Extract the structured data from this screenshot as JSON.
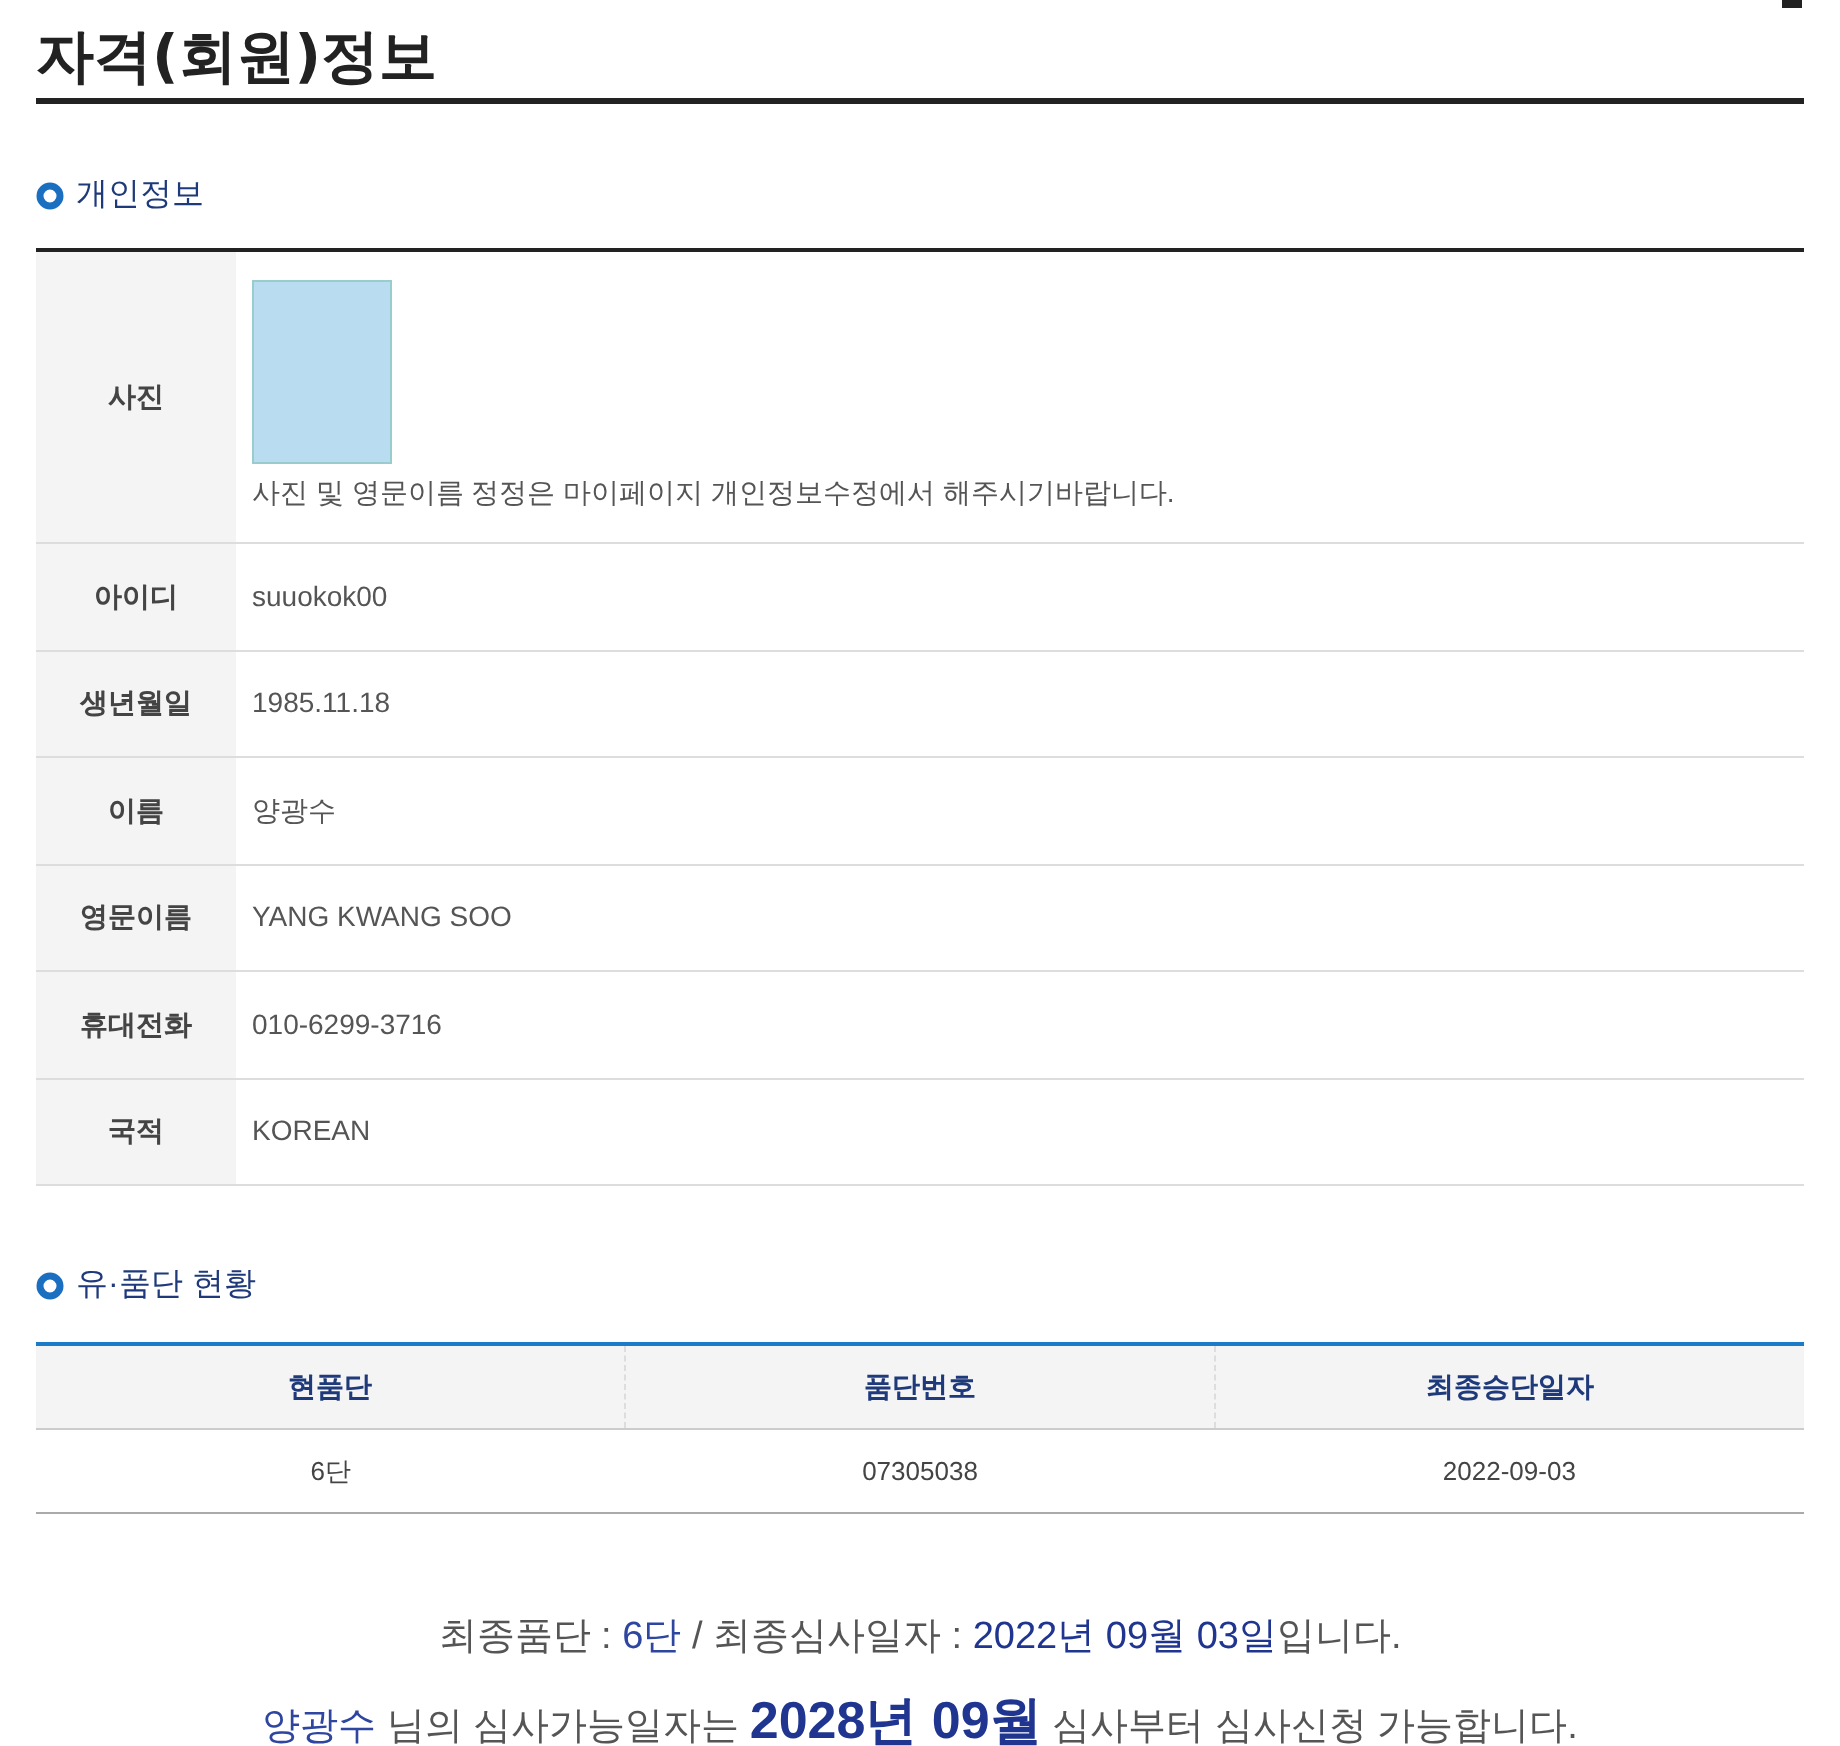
{
  "page_title": "자격(회원)정보",
  "personal_section": {
    "heading": "개인정보",
    "photo_row": {
      "label": "사진",
      "note": "사진 및 영문이름 정정은 마이페이지 개인정보수정에서 해주시기바랍니다."
    },
    "rows": [
      {
        "label": "아이디",
        "value": "suuokok00"
      },
      {
        "label": "생년월일",
        "value": "1985.11.18"
      },
      {
        "label": "이름",
        "value": "양광수"
      },
      {
        "label": "영문이름",
        "value": "YANG KWANG SOO"
      },
      {
        "label": "휴대전화",
        "value": "010-6299-3716"
      },
      {
        "label": "국적",
        "value": "KOREAN"
      }
    ]
  },
  "rank_section": {
    "heading": "유·품단 현황",
    "columns": [
      "현품단",
      "품단번호",
      "최종승단일자"
    ],
    "rows": [
      [
        "6단",
        "07305038",
        "2022-09-03"
      ]
    ]
  },
  "summary_lines": [
    [
      {
        "kind": "plain",
        "text": "최종품단 : "
      },
      {
        "kind": "accent",
        "text": "6단"
      },
      {
        "kind": "plain",
        "text": " / 최종심사일자 : "
      },
      {
        "kind": "strong",
        "text": "2022년 09월 03일"
      },
      {
        "kind": "plain",
        "text": "입니다."
      }
    ],
    [
      {
        "kind": "accent",
        "text": "양광수"
      },
      {
        "kind": "plain",
        "text": " 님의 심사가능일자는 "
      },
      {
        "kind": "big",
        "text": "2028년 09월"
      },
      {
        "kind": "plain",
        "text": " 심사부터 심사신청 가능합니다."
      }
    ]
  ]
}
